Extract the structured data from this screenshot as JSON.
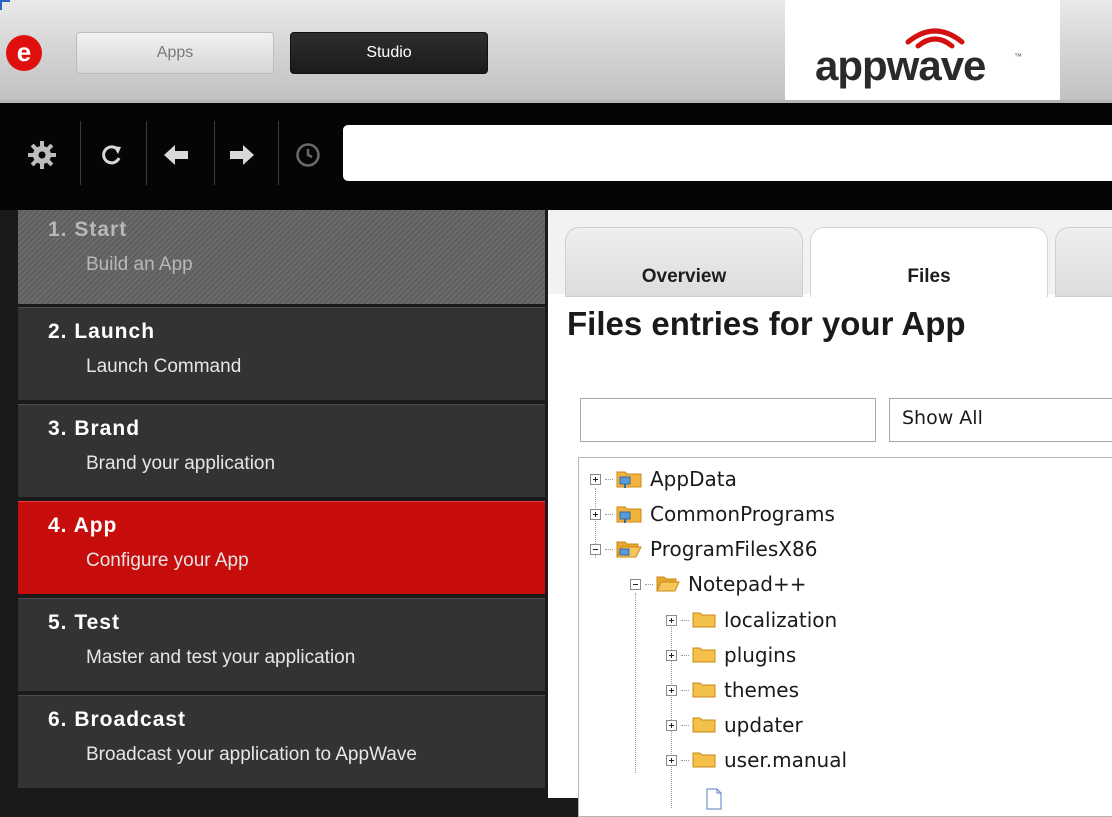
{
  "header": {
    "logo_letter": "e",
    "tabs": [
      {
        "label": "Apps",
        "active": false
      },
      {
        "label": "Studio",
        "active": true
      }
    ],
    "brand": "appwave",
    "brand_tm": "™"
  },
  "toolbar": {
    "buttons": [
      "gear-icon",
      "refresh-icon",
      "back-arrow-icon",
      "forward-arrow-icon",
      "history-clock-icon"
    ],
    "address_value": ""
  },
  "sidebar": {
    "steps": [
      {
        "number": "1. Start",
        "subtitle": "Build an App",
        "state": "disabled"
      },
      {
        "number": "2. Launch",
        "subtitle": "Launch Command",
        "state": "normal"
      },
      {
        "number": "3. Brand",
        "subtitle": "Brand your application",
        "state": "normal"
      },
      {
        "number": "4. App",
        "subtitle": "Configure your App",
        "state": "active"
      },
      {
        "number": "5. Test",
        "subtitle": "Master and test your application",
        "state": "normal"
      },
      {
        "number": "6. Broadcast",
        "subtitle": "Broadcast your application to AppWave",
        "state": "normal"
      }
    ]
  },
  "main": {
    "tabs": [
      {
        "label": "Overview",
        "active": false
      },
      {
        "label": "Files",
        "active": true
      },
      {
        "label": "",
        "active": false
      }
    ],
    "title": "Files entries for your App",
    "filter_value": "",
    "show_select": "Show All",
    "tree": [
      {
        "label": "AppData",
        "level": 0,
        "expanded": false,
        "icon": "folder-network-icon"
      },
      {
        "label": "CommonPrograms",
        "level": 0,
        "expanded": false,
        "icon": "folder-network-icon"
      },
      {
        "label": "ProgramFilesX86",
        "level": 0,
        "expanded": true,
        "icon": "folder-network-icon"
      },
      {
        "label": "Notepad++",
        "level": 1,
        "expanded": true,
        "icon": "folder-open-icon"
      },
      {
        "label": "localization",
        "level": 2,
        "expanded": false,
        "icon": "folder-icon"
      },
      {
        "label": "plugins",
        "level": 2,
        "expanded": false,
        "icon": "folder-icon"
      },
      {
        "label": "themes",
        "level": 2,
        "expanded": false,
        "icon": "folder-icon"
      },
      {
        "label": "updater",
        "level": 2,
        "expanded": false,
        "icon": "folder-icon"
      },
      {
        "label": "user.manual",
        "level": 2,
        "expanded": false,
        "icon": "folder-icon"
      }
    ]
  },
  "colors": {
    "accent_red": "#c70c0c",
    "sidebar_bg": "#333333",
    "toolbar_bg": "#050505"
  }
}
